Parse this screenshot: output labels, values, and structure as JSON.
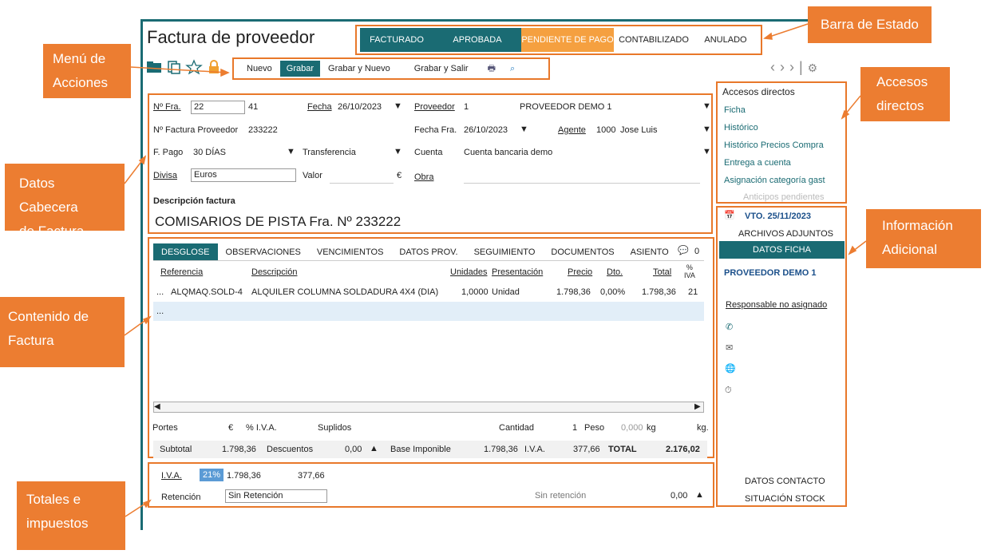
{
  "title": "Factura de proveedor",
  "status": [
    "FACTURADO",
    "APROBADA",
    "PENDIENTE DE PAGO",
    "CONTABILIZADO",
    "ANULADO"
  ],
  "actions": [
    "Nuevo",
    "Grabar",
    "Grabar y Nuevo",
    "Grabar y Salir"
  ],
  "header": {
    "nfra_label": "Nº Fra.",
    "nfra_serie": "22",
    "nfra_num": "41",
    "fecha_label": "Fecha",
    "fecha": "26/10/2023",
    "proveedor_label": "Proveedor",
    "proveedor_code": "1",
    "proveedor_name": "PROVEEDOR DEMO 1",
    "nfp_label": "Nº Factura Proveedor",
    "nfp": "233222",
    "fechafra_label": "Fecha Fra.",
    "fechafra": "26/10/2023",
    "agente_label": "Agente",
    "agente_code": "1000",
    "agente_name": "Jose Luis",
    "fpago_label": "F. Pago",
    "fpago": "30 DÍAS",
    "fpago_tipo": "Transferencia",
    "cuenta_label": "Cuenta",
    "cuenta": "Cuenta bancaria demo",
    "divisa_label": "Divisa",
    "divisa": "Euros",
    "valor_label": "Valor",
    "euro": "€",
    "obra_label": "Obra",
    "desc_label": "Descripción factura",
    "desc": "COMISARIOS DE PISTA Fra. Nº 233222"
  },
  "tabs": [
    "DESGLOSE",
    "OBSERVACIONES",
    "VENCIMIENTOS",
    "DATOS PROV.",
    "SEGUIMIENTO",
    "DOCUMENTOS",
    "ASIENTO"
  ],
  "comments": "0",
  "cols": [
    "Referencia",
    "Descripción",
    "Unidades",
    "Presentación",
    "Precio",
    "Dto.",
    "Total",
    "%\nIVA"
  ],
  "line": {
    "dots": "...",
    "ref": "ALQMAQ.SOLD-4",
    "desc": "ALQUILER COLUMNA SOLDADURA 4X4 (DIA)",
    "uds": "1,0000",
    "pres": "Unidad",
    "precio": "1.798,36",
    "dto": "0,00%",
    "total": "1.798,36",
    "iva": "21"
  },
  "dots2": "...",
  "foot1": {
    "portes": "Portes",
    "euro": "€",
    "piva": "% I.V.A.",
    "suplidos": "Suplidos",
    "cantidad": "Cantidad",
    "cant_val": "1",
    "peso": "Peso",
    "peso_val": "0,000",
    "kg": "kg",
    "kg2": "kg."
  },
  "foot2": {
    "subtotal": "Subtotal",
    "subtotal_val": "1.798,36",
    "desc": "Descuentos",
    "desc_val": "0,00",
    "base": "Base Imponible",
    "base_val": "1.798,36",
    "iva": "I.V.A.",
    "iva_val": "377,66",
    "total": "TOTAL",
    "total_val": "2.176,02"
  },
  "taxes": {
    "iva_label": "I.V.A.",
    "pct": "21%",
    "base": "1.798,36",
    "cuota": "377,66",
    "ret_label": "Retención",
    "ret": "Sin Retención",
    "sinret": "Sin retención",
    "sinret_val": "0,00"
  },
  "accesos": {
    "title": "Accesos directos",
    "items": [
      "Ficha",
      "Histórico",
      "Histórico Precios Compra",
      "Entrega a cuenta",
      "Asignación categoría gast"
    ],
    "disabled": "Anticipos pendientes"
  },
  "info": {
    "vto": "VTO. 25/11/2023",
    "adjuntos": "ARCHIVOS ADJUNTOS",
    "datos_ficha": "DATOS FICHA",
    "proveedor": "PROVEEDOR DEMO 1",
    "responsable": "Responsable no asignado",
    "contacto": "DATOS CONTACTO",
    "stock": "SITUACIÓN STOCK"
  },
  "callouts": {
    "barra": "Barra de Estado",
    "menu": "Menú de\nAcciones",
    "accesos": "Accesos\ndirectos",
    "datos": "Datos Cabecera\nde Factura",
    "info": "Información\nAdicional",
    "contenido": "Contenido de\nFactura",
    "totales": "Totales e\nimpuestos"
  }
}
